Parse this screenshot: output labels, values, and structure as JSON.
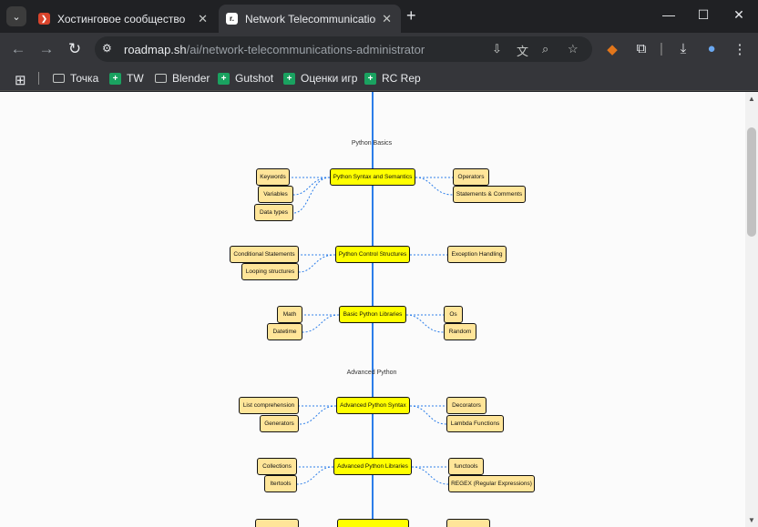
{
  "browser": {
    "tab_menu_icon": "chevron-down-icon",
    "tabs": [
      {
        "title": "Хостинговое сообщество «Tim",
        "favicon": "timeweb-favicon",
        "active": false
      },
      {
        "title": "Network Telecommunications A",
        "favicon": "roadmap-favicon",
        "active": true
      }
    ],
    "url_host": "roadmap.sh",
    "url_path": "/ai/network-telecommunications-administrator",
    "bookmarks": [
      {
        "label": "Точка",
        "icon": "folder-icon"
      },
      {
        "label": "TW",
        "icon": "green-bookmark-icon"
      },
      {
        "label": "Blender",
        "icon": "folder-icon"
      },
      {
        "label": "Gutshot",
        "icon": "green-bookmark-icon"
      },
      {
        "label": "Оценки игр",
        "icon": "green-bookmark-icon"
      },
      {
        "label": "RC Rep",
        "icon": "green-bookmark-icon"
      }
    ]
  },
  "roadmap": {
    "sections": [
      {
        "label": "Python Basics"
      },
      {
        "label": "Advanced Python"
      }
    ],
    "main_nodes": [
      {
        "label": "Python Syntax and Semantics"
      },
      {
        "label": "Python Control Structures"
      },
      {
        "label": "Basic Python Libraries"
      },
      {
        "label": "Advanced Python Syntax"
      },
      {
        "label": "Advanced Python Libraries"
      }
    ],
    "sub_nodes": [
      {
        "label": "Keywords"
      },
      {
        "label": "Variables"
      },
      {
        "label": "Data types"
      },
      {
        "label": "Operators"
      },
      {
        "label": "Statements & Comments"
      },
      {
        "label": "Conditional Statements"
      },
      {
        "label": "Looping structures"
      },
      {
        "label": "Exception Handling"
      },
      {
        "label": "Math"
      },
      {
        "label": "Datetime"
      },
      {
        "label": "Os"
      },
      {
        "label": "Random"
      },
      {
        "label": "List comprehension"
      },
      {
        "label": "Generators"
      },
      {
        "label": "Decorators"
      },
      {
        "label": "Lambda Functions"
      },
      {
        "label": "Collections"
      },
      {
        "label": "Itertools"
      },
      {
        "label": "functools"
      },
      {
        "label": "REGEX (Regular Expressions)"
      }
    ]
  },
  "colors": {
    "main_node": "#ffff00",
    "sub_node": "#ffe599",
    "spine": "#2b7de9",
    "link": "#2b7de9"
  }
}
